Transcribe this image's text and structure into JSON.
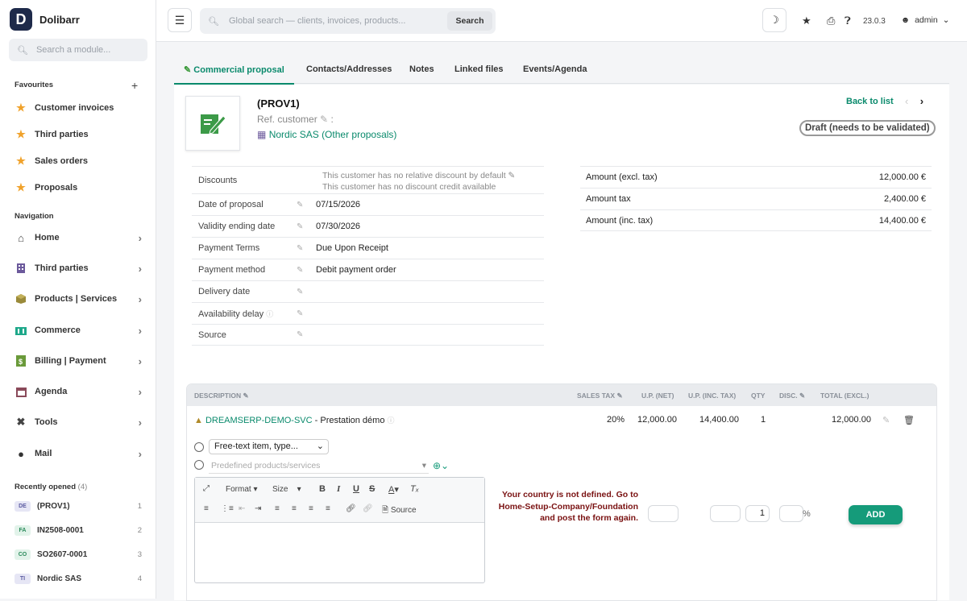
{
  "app": {
    "name": "Dolibarr",
    "logo_letter": "D",
    "version": "23.0.3",
    "user": "admin"
  },
  "sidebar": {
    "search_placeholder": "Search a module...",
    "favourites_title": "Favourites",
    "favourites": [
      {
        "label": "Customer invoices"
      },
      {
        "label": "Third parties"
      },
      {
        "label": "Sales orders"
      },
      {
        "label": "Proposals"
      }
    ],
    "navigation_title": "Navigation",
    "navigation": [
      {
        "label": "Home",
        "icon": "home-icon"
      },
      {
        "label": "Third parties",
        "icon": "building-icon"
      },
      {
        "label": "Products | Services",
        "icon": "box-icon"
      },
      {
        "label": "Commerce",
        "icon": "commerce-icon"
      },
      {
        "label": "Billing | Payment",
        "icon": "billing-icon"
      },
      {
        "label": "Agenda",
        "icon": "calendar-icon"
      },
      {
        "label": "Tools",
        "icon": "tools-icon"
      },
      {
        "label": "Mail",
        "icon": "mail-icon"
      }
    ],
    "recent_title": "Recently opened",
    "recent_count": "(4)",
    "recent": [
      {
        "badge": "DE",
        "label": "(PROV1)",
        "num": "1"
      },
      {
        "badge": "FA",
        "label": "IN2508-0001",
        "num": "2"
      },
      {
        "badge": "CO",
        "label": "SO2607-0001",
        "num": "3"
      },
      {
        "badge": "TI",
        "label": "Nordic SAS",
        "num": "4"
      }
    ]
  },
  "topbar": {
    "search_placeholder": "Global search — clients, invoices, products...",
    "search_button": "Search"
  },
  "tabs": [
    "Commercial proposal",
    "Contacts/Addresses",
    "Notes",
    "Linked files",
    "Events/Agenda"
  ],
  "header": {
    "ref": "(PROV1)",
    "ref_customer": "Ref. customer",
    "ref_customer_sep": ":",
    "thirdparty": "Nordic SAS",
    "other_proposals": "(Other proposals)",
    "back_to_list": "Back to list",
    "status": "Draft (needs to be validated)"
  },
  "fields": {
    "discounts_label": "Discounts",
    "discount_line1": "This customer has no relative discount by default",
    "discount_line2": "This customer has no discount credit available",
    "rows": [
      {
        "label": "Date of proposal",
        "value": "07/15/2026"
      },
      {
        "label": "Validity ending date",
        "value": "07/30/2026"
      },
      {
        "label": "Payment Terms",
        "value": "Due Upon Receipt"
      },
      {
        "label": "Payment method",
        "value": "Debit payment order"
      },
      {
        "label": "Delivery date",
        "value": ""
      },
      {
        "label": "Availability delay",
        "value": ""
      },
      {
        "label": "Source",
        "value": ""
      }
    ]
  },
  "amounts": [
    {
      "label": "Amount (excl. tax)",
      "value": "12,000.00 €"
    },
    {
      "label": "Amount tax",
      "value": "2,400.00 €"
    },
    {
      "label": "Amount (inc. tax)",
      "value": "14,400.00 €"
    }
  ],
  "lines": {
    "headers": {
      "description": "DESCRIPTION",
      "sales_tax": "SALES TAX",
      "up_net": "U.P. (NET)",
      "up_inc": "U.P. (INC. TAX)",
      "qty": "QTY",
      "disc": "DISC.",
      "total": "TOTAL (EXCL.)"
    },
    "row": {
      "product": "DREAMSERP-DEMO-SVC",
      "desc": " - Prestation démo",
      "tax": "20%",
      "up_net": "12,000.00",
      "up_inc": "14,400.00",
      "qty": "1",
      "total": "12,000.00"
    },
    "free_text_option": "Free-text item, type...",
    "predefined_placeholder": "Predefined products/services",
    "editor": {
      "format": "Format",
      "size": "Size",
      "source": "Source"
    },
    "warning": "Your country is not defined. Go to Home-Setup-Company/Foundation and post the form again.",
    "qty_value": "1",
    "percent": "%",
    "add_button": "ADD"
  }
}
